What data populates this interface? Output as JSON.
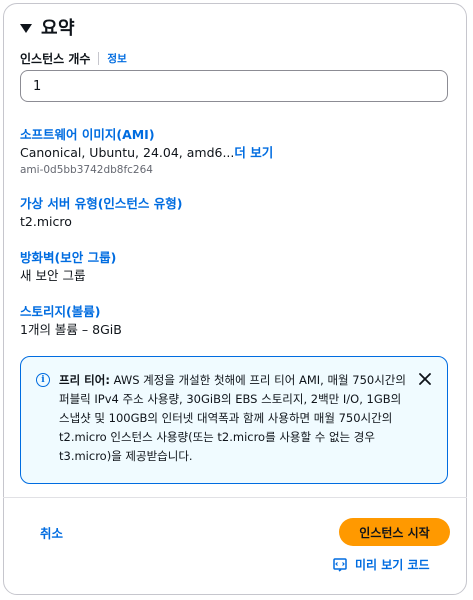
{
  "summary": {
    "title": "요약",
    "instance_count_label": "인스턴스 개수",
    "info_link": "정보",
    "instance_count_value": "1"
  },
  "sections": {
    "ami": {
      "title": "소프트웨어 이미지(AMI)",
      "value": "Canonical, Ubuntu, 24.04, amd6...",
      "more_link": "더 보기",
      "id": "ami-0d5bb3742db8fc264"
    },
    "instance_type": {
      "title": "가상 서버 유형(인스턴스 유형)",
      "value": "t2.micro"
    },
    "firewall": {
      "title": "방화벽(보안 그룹)",
      "value": "새 보안 그룹"
    },
    "storage": {
      "title": "스토리지(볼륨)",
      "value": "1개의 볼륨 – 8GiB"
    }
  },
  "free_tier_alert": {
    "label": "프리 티어:",
    "text": " AWS 계정을 개설한 첫해에 프리 티어 AMI, 매월 750시간의 퍼블릭 IPv4 주소 사용량, 30GiB의 EBS 스토리지, 2백만 I/O, 1GB의 스냅샷 및 100GB의 인터넷 대역폭과 함께 사용하면 매월 750시간의 t2.micro 인스턴스 사용량(또는 t2.micro를 사용할 수 없는 경우 t3.micro)을 제공받습니다.",
    "info_glyph": "i"
  },
  "footer": {
    "cancel": "취소",
    "launch": "인스턴스 시작",
    "preview_code": "미리 보기 코드"
  },
  "colors": {
    "link": "#006ce0",
    "primary_button": "#ff9900",
    "alert_bg": "#f0fbff"
  }
}
